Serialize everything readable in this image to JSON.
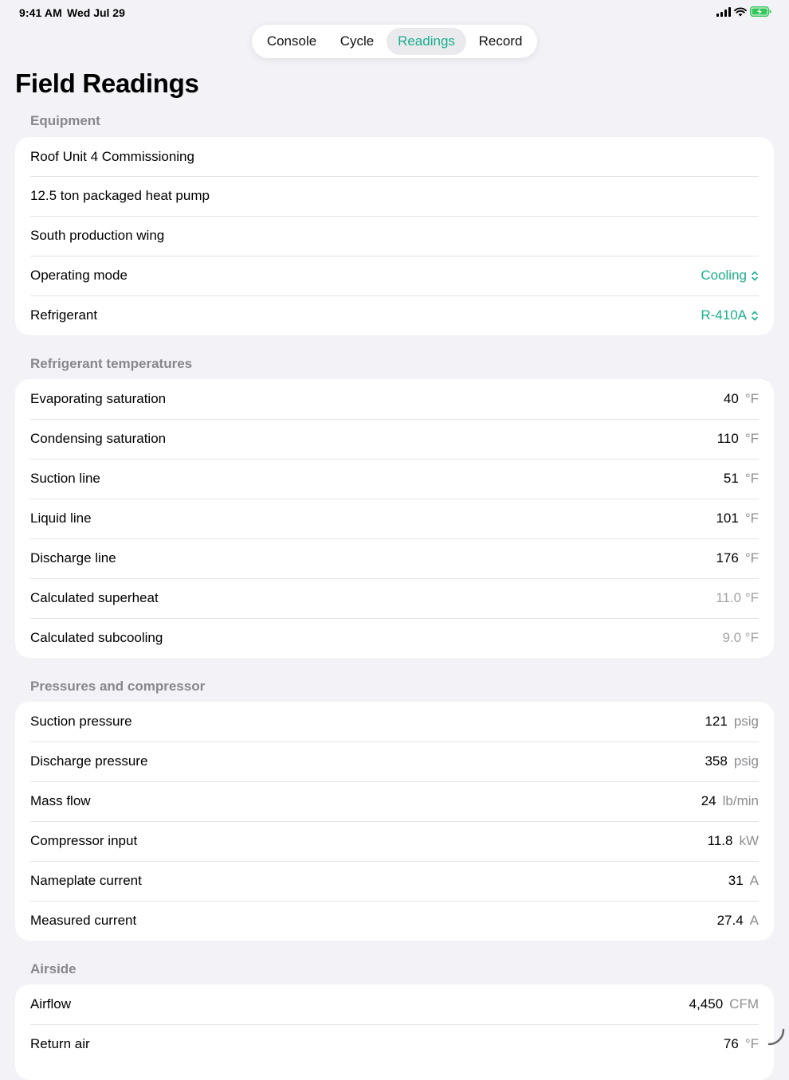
{
  "status": {
    "time": "9:41 AM",
    "date": "Wed Jul 29"
  },
  "tabs": [
    "Console",
    "Cycle",
    "Readings",
    "Record"
  ],
  "active_tab": "Readings",
  "title": "Field Readings",
  "colors": {
    "accent": "#1aaf8c",
    "background": "#f2f2f7",
    "secondary": "#8e8e93"
  },
  "equipment": {
    "header": "Equipment",
    "name": "Roof Unit 4 Commissioning",
    "model": "12.5 ton packaged heat pump",
    "location": "South production wing",
    "operating_mode": {
      "label": "Operating mode",
      "value": "Cooling"
    },
    "refrigerant": {
      "label": "Refrigerant",
      "value": "R-410A"
    }
  },
  "temps": {
    "header": "Refrigerant temperatures",
    "rows": [
      {
        "label": "Evaporating saturation",
        "value": "40",
        "unit": "°F"
      },
      {
        "label": "Condensing saturation",
        "value": "110",
        "unit": "°F"
      },
      {
        "label": "Suction line",
        "value": "51",
        "unit": "°F"
      },
      {
        "label": "Liquid line",
        "value": "101",
        "unit": "°F"
      },
      {
        "label": "Discharge line",
        "value": "176",
        "unit": "°F"
      },
      {
        "label": "Calculated superheat",
        "value": "11.0 °F"
      },
      {
        "label": "Calculated subcooling",
        "value": "9.0 °F"
      }
    ]
  },
  "pressures": {
    "header": "Pressures and compressor",
    "rows": [
      {
        "label": "Suction pressure",
        "value": "121",
        "unit": "psig"
      },
      {
        "label": "Discharge pressure",
        "value": "358",
        "unit": "psig"
      },
      {
        "label": "Mass flow",
        "value": "24",
        "unit": "lb/min"
      },
      {
        "label": "Compressor input",
        "value": "11.8",
        "unit": "kW"
      },
      {
        "label": "Nameplate current",
        "value": "31",
        "unit": "A"
      },
      {
        "label": "Measured current",
        "value": "27.4",
        "unit": "A"
      }
    ]
  },
  "airside": {
    "header": "Airside",
    "rows": [
      {
        "label": "Airflow",
        "value": "4,450",
        "unit": "CFM"
      },
      {
        "label": "Return air",
        "value": "76",
        "unit": "°F"
      }
    ]
  }
}
